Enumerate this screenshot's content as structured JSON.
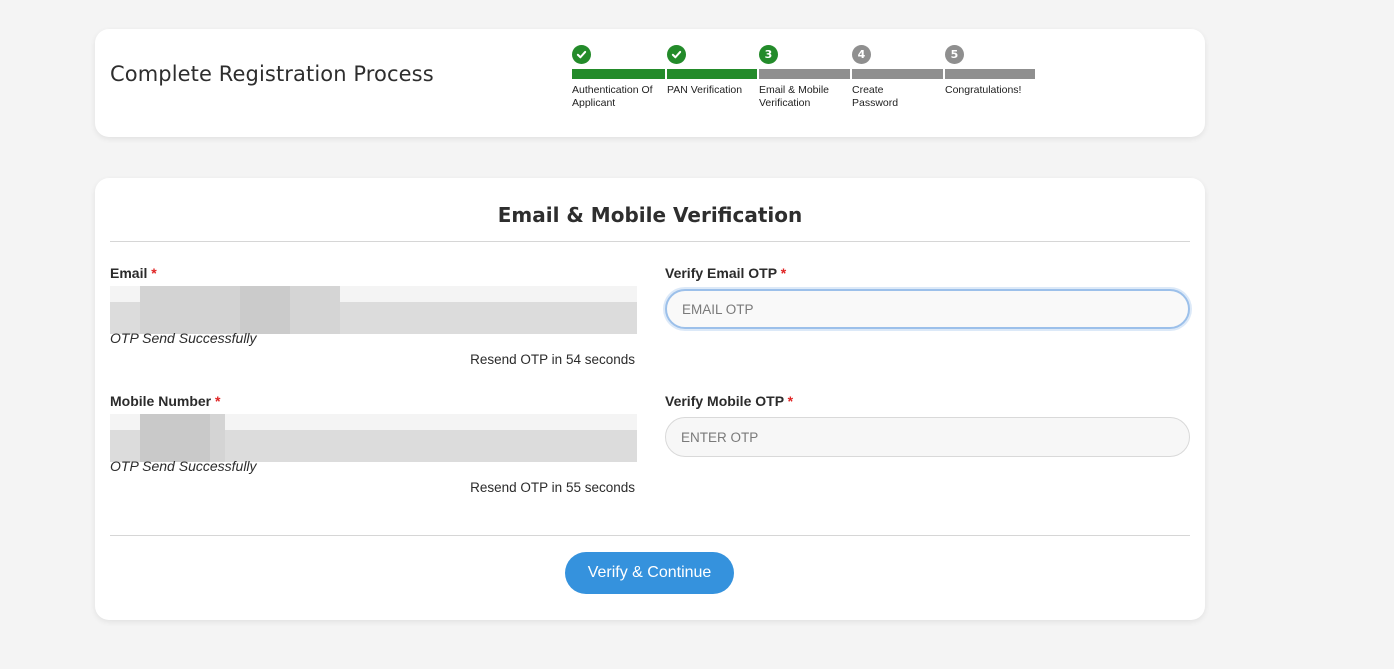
{
  "header": {
    "title": "Complete Registration Process"
  },
  "stepper": {
    "steps": [
      {
        "number": "1",
        "label": "Authentication Of Applicant",
        "state": "done"
      },
      {
        "number": "2",
        "label": "PAN Verification",
        "state": "done"
      },
      {
        "number": "3",
        "label": "Email & Mobile Verification",
        "state": "current"
      },
      {
        "number": "4",
        "label": "Create Password",
        "state": "pending"
      },
      {
        "number": "5",
        "label": "Congratulations!",
        "state": "pending"
      }
    ],
    "colors": {
      "done": "#238b2a",
      "pending": "#8f8f8f"
    }
  },
  "form": {
    "title": "Email & Mobile Verification",
    "email": {
      "label": "Email",
      "required_mark": "*",
      "status": "OTP Send Successfully",
      "resend": "Resend OTP in 54 seconds"
    },
    "mobile": {
      "label": "Mobile Number",
      "required_mark": "*",
      "status": "OTP Send Successfully",
      "resend": "Resend OTP in 55 seconds"
    },
    "email_otp": {
      "label": "Verify Email OTP",
      "required_mark": "*",
      "placeholder": "EMAIL OTP",
      "value": ""
    },
    "mobile_otp": {
      "label": "Verify Mobile OTP",
      "required_mark": "*",
      "placeholder": "ENTER OTP",
      "value": ""
    },
    "submit_label": "Verify & Continue",
    "accent_color": "#3592dd"
  }
}
